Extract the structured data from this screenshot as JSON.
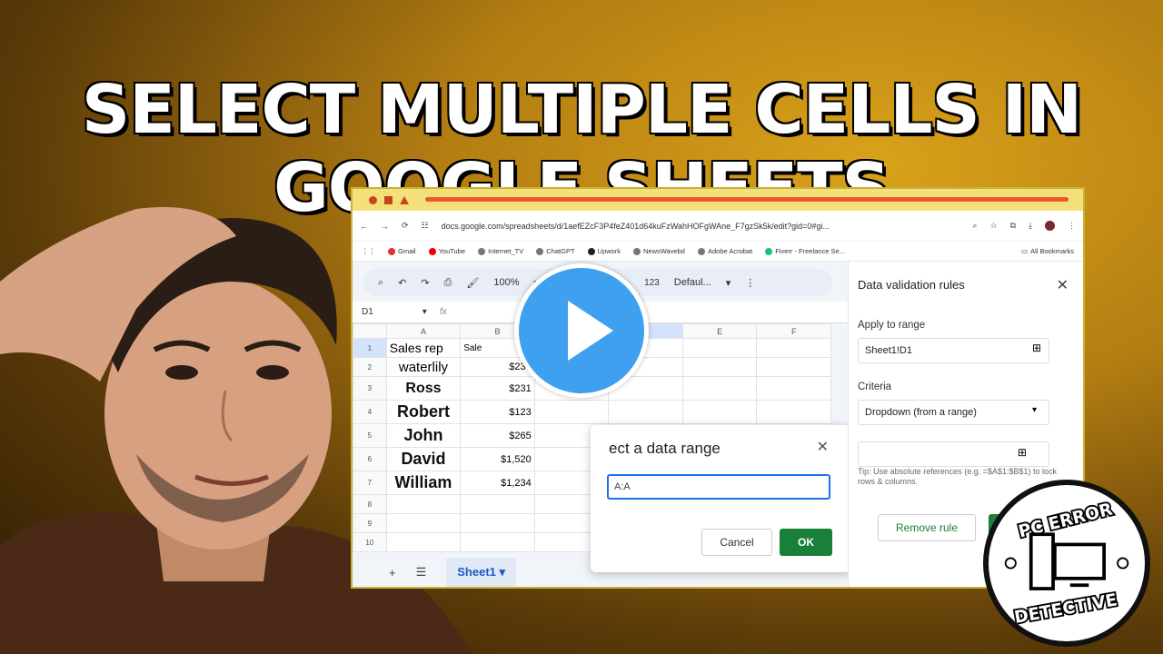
{
  "thumbnail": {
    "title": "SELECT MULTIPLE CELLS IN GOOGLE SHEETS"
  },
  "browser": {
    "url": "docs.google.com/spreadsheets/d/1aefEZcF3P4feZ401d64kuFzWahHOFgWAne_F7gzSk5k/edit?gid=0#gi...",
    "bookmarks": [
      "Gmail",
      "YouTube",
      "Internet_TV",
      "ChatGPT",
      "Upwork",
      "NewsWavebd",
      "Adobe Acrobat",
      "Fiverr - Freelance Se..."
    ],
    "all_bookmarks": "All Bookmarks"
  },
  "sheet": {
    "zoom": "100%",
    "format_num": "123",
    "font": "Defaul...",
    "cell_ref": "D1",
    "fx": "fx",
    "columns": [
      "A",
      "B",
      "C",
      "D",
      "E",
      "F"
    ],
    "rows": [
      {
        "n": "1",
        "a": "Sales rep",
        "b": "Sale"
      },
      {
        "n": "2",
        "a": "waterlily",
        "b": "$230"
      },
      {
        "n": "3",
        "a": "Ross",
        "b": "$231"
      },
      {
        "n": "4",
        "a": "Robert",
        "b": "$123"
      },
      {
        "n": "5",
        "a": "John",
        "b": "$265"
      },
      {
        "n": "6",
        "a": "David",
        "b": "$1,520"
      },
      {
        "n": "7",
        "a": "William",
        "b": "$1,234"
      },
      {
        "n": "8",
        "a": "",
        "b": ""
      },
      {
        "n": "9",
        "a": "",
        "b": ""
      },
      {
        "n": "10",
        "a": "",
        "b": ""
      }
    ],
    "tab": "Sheet1"
  },
  "dialog": {
    "title": "ect a data range",
    "input_value": "A:A",
    "cancel": "Cancel",
    "ok": "OK"
  },
  "panel": {
    "title": "Data validation rules",
    "apply_label": "Apply to range",
    "apply_value": "Sheet1!D1",
    "criteria_label": "Criteria",
    "criteria_value": "Dropdown (from a range)",
    "tip": "Tip: Use absolute references (e.g. =$A$1:$B$1) to lock rows & columns.",
    "remove": "Remove rule"
  },
  "logo": {
    "top": "PC ERROR",
    "bottom": "DETECTIVE"
  },
  "colors": {
    "accent": "#188038",
    "play": "#3fa0f0",
    "background": "#b37d12"
  }
}
